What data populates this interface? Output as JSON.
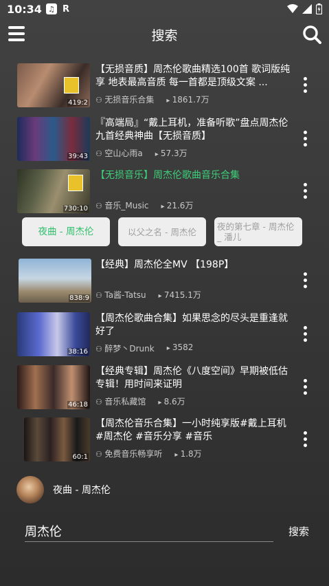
{
  "status": {
    "time": "10:34",
    "r_label": "R"
  },
  "header": {
    "title": "搜索"
  },
  "results": [
    {
      "title": "【无损音质】周杰伦歌曲精选100首 歌词版纯享 地表最高音质 每一首都是顶级文案 ...",
      "uploader": "无损音乐合集",
      "plays": "1861.7万",
      "duration": "419:2",
      "green": false
    },
    {
      "title": "『高端局』“戴上耳机，准备听歌”盘点周杰伦九首经典神曲【无损音质】",
      "uploader": "空山心雨a",
      "plays": "57.3万",
      "duration": "39:43",
      "green": false
    },
    {
      "title": "【无损音乐】周杰伦歌曲音乐合集",
      "uploader": "音乐_Music",
      "plays": "21.6万",
      "duration": "730:10",
      "green": true
    },
    {
      "title": "【经典】周杰伦全MV 【198P】",
      "uploader": "Ta酱-Tatsu",
      "plays": "7415.1万",
      "duration": "838:9",
      "green": false
    },
    {
      "title": "【周杰伦歌曲合集】如果思念的尽头是重逢就好了",
      "uploader": "醉梦丶Drunk",
      "plays": "3582",
      "duration": "38:16",
      "green": false
    },
    {
      "title": "【经典专辑】周杰伦《八度空间》早期被低估专辑！用时间来证明",
      "uploader": "音乐私藏馆",
      "plays": "8.6万",
      "duration": "46:18",
      "green": false
    },
    {
      "title": "【周杰伦音乐合集】一小时纯享版#戴上耳机 #周杰伦 #音乐分享 #音乐",
      "uploader": "免费音乐畅享听",
      "plays": "1.8万",
      "duration": "60:1",
      "green": false
    }
  ],
  "chips": [
    {
      "label": "夜曲 - 周杰伦",
      "active": true
    },
    {
      "label": "以父之名 - 周杰伦",
      "active": false
    },
    {
      "label": "夜的第七章 - 周杰伦 _ 潘儿",
      "active": false
    }
  ],
  "player": {
    "song": "夜曲 - 周杰伦"
  },
  "search": {
    "value": "周杰伦",
    "button": "搜索"
  },
  "colors": {
    "accent": "#3dcf7a",
    "background": "#3a3a3a"
  }
}
